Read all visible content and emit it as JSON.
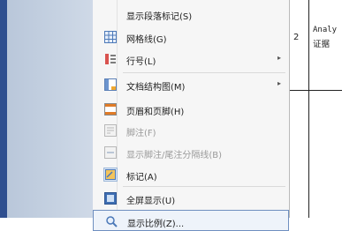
{
  "menu": {
    "items": [
      {
        "label": "显示段落标记(S)",
        "icon": "",
        "arrow": false,
        "disabled": false
      },
      {
        "label": "网格线(G)",
        "icon": "grid-icon",
        "arrow": false,
        "disabled": false
      },
      {
        "label": "行号(L)",
        "icon": "line-numbers-icon",
        "arrow": true,
        "disabled": false
      },
      {
        "label": "文档结构图(M)",
        "icon": "document-map-icon",
        "arrow": true,
        "disabled": false
      },
      {
        "label": "页眉和页脚(H)",
        "icon": "header-footer-icon",
        "arrow": false,
        "disabled": false
      },
      {
        "label": "脚注(F)",
        "icon": "footnote-icon",
        "arrow": false,
        "disabled": true
      },
      {
        "label": "显示脚注/尾注分隔线(B)",
        "icon": "separator-icon",
        "arrow": false,
        "disabled": true
      },
      {
        "label": "标记(A)",
        "icon": "markup-icon",
        "arrow": false,
        "disabled": false,
        "checked": true
      },
      {
        "label": "全屏显示(U)",
        "icon": "fullscreen-icon",
        "arrow": false,
        "disabled": false
      },
      {
        "label": "显示比例(Z)...",
        "icon": "zoom-icon",
        "arrow": false,
        "disabled": false
      }
    ],
    "arrow_glyph": "▸"
  },
  "table": {
    "row_number": "2",
    "cell_line1": "Analy",
    "cell_line2": "证据"
  },
  "colors": {
    "menu_bg": "#f6f6f6",
    "accent_blue": "#2f4f8f",
    "focus_border": "#6f8fc0"
  }
}
